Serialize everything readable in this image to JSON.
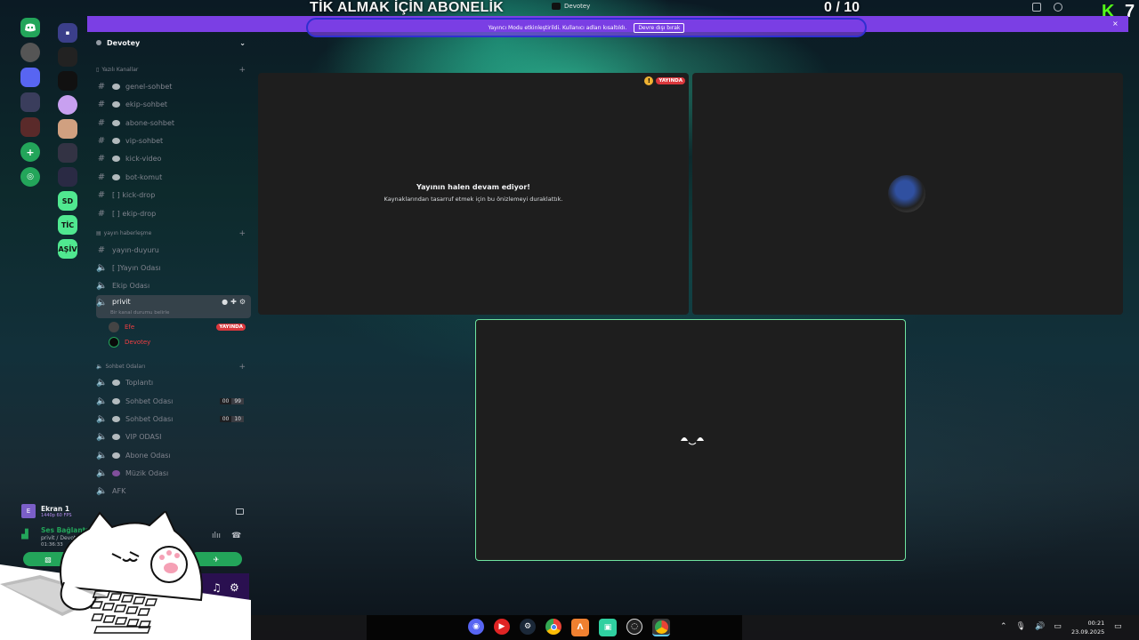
{
  "overlay": {
    "title": "TİK ALMAK İÇİN ABONELİK",
    "counter": "0  / 10",
    "window_title": "Devotey",
    "kick_letter": "K",
    "kick_number": "7"
  },
  "streamer_mode": {
    "message": "Yayıncı Modu etkinleştirildi. Kullanıcı adları kısaltıldı.",
    "button": "Devre dışı bırak",
    "close": "×"
  },
  "server_rail": {
    "servers_left": [
      "discord-home",
      "server-1",
      "server-2",
      "server-3",
      "server-4",
      "add-server",
      "explore"
    ],
    "servers_right": [
      "folder",
      "server-a",
      "server-b",
      "server-c",
      "server-d",
      "server-e",
      "server-f"
    ],
    "labels_right": [
      "SD",
      "TİC",
      "AŞİV"
    ]
  },
  "server": {
    "name": "Devotey"
  },
  "categories": {
    "text": "Yazılı Kanallar",
    "announcements": "yayın haberleşme",
    "chat": "Sohbet Odaları"
  },
  "text_channels": [
    {
      "name": "genel-sohbet"
    },
    {
      "name": "ekip-sohbet"
    },
    {
      "name": "abone-sohbet"
    },
    {
      "name": "vip-sohbet"
    },
    {
      "name": "kick-video"
    },
    {
      "name": "bot-komut"
    },
    {
      "name": "[ ] kick-drop"
    },
    {
      "name": "[ ] ekip-drop"
    }
  ],
  "announce_channels": [
    {
      "name": "yayın-duyuru"
    },
    {
      "name": "[ ]Yayın Odası"
    },
    {
      "name": "Ekip Odası"
    }
  ],
  "active_voice": {
    "name": "privit",
    "status": "Bir kanal durumu belirle",
    "users": [
      {
        "name": "Efe",
        "badge": "YAYINDA"
      },
      {
        "name": "Devotey",
        "badge": ""
      }
    ]
  },
  "chat_channels": [
    {
      "name": "Toplantı",
      "limit_a": "",
      "limit_b": ""
    },
    {
      "name": "Sohbet Odası",
      "limit_a": "00",
      "limit_b": "99"
    },
    {
      "name": "Sohbet Odası",
      "limit_a": "00",
      "limit_b": "10"
    },
    {
      "name": "VIP ODASI",
      "limit_a": "",
      "limit_b": ""
    },
    {
      "name": "Abone Odası",
      "limit_a": "",
      "limit_b": ""
    },
    {
      "name": "Müzik Odası",
      "limit_a": "",
      "limit_b": ""
    },
    {
      "name": "AFK",
      "limit_a": "",
      "limit_b": ""
    }
  ],
  "screen_share": {
    "title": "Ekran 1",
    "quality": "1440p 60 FPS",
    "thumb": "E"
  },
  "voice_connection": {
    "status": "Ses Bağlantısı",
    "location": "privit / Devotey",
    "time": "01:36:33"
  },
  "tiles": {
    "paused_title": "Yayının halen devam ediyor!",
    "paused_desc": "Kaynaklarından tasarruf etmek için bu önizlemeyi duraklattık.",
    "live_badge": "YAYINDA",
    "warn": "!"
  },
  "taskbar": {
    "apps": [
      "discord-icon",
      "youtube-music-icon",
      "steam-icon",
      "chrome-icon",
      "app-a-icon",
      "app-b-icon",
      "obs-icon",
      "chrome-2-icon"
    ],
    "time": "00:21",
    "date": "23.09.2025"
  },
  "colors": {
    "accent_green": "#23a55a",
    "streamer_bar": "#7b3fe4",
    "live_red": "#da373c",
    "kick_green": "#53fc18"
  }
}
